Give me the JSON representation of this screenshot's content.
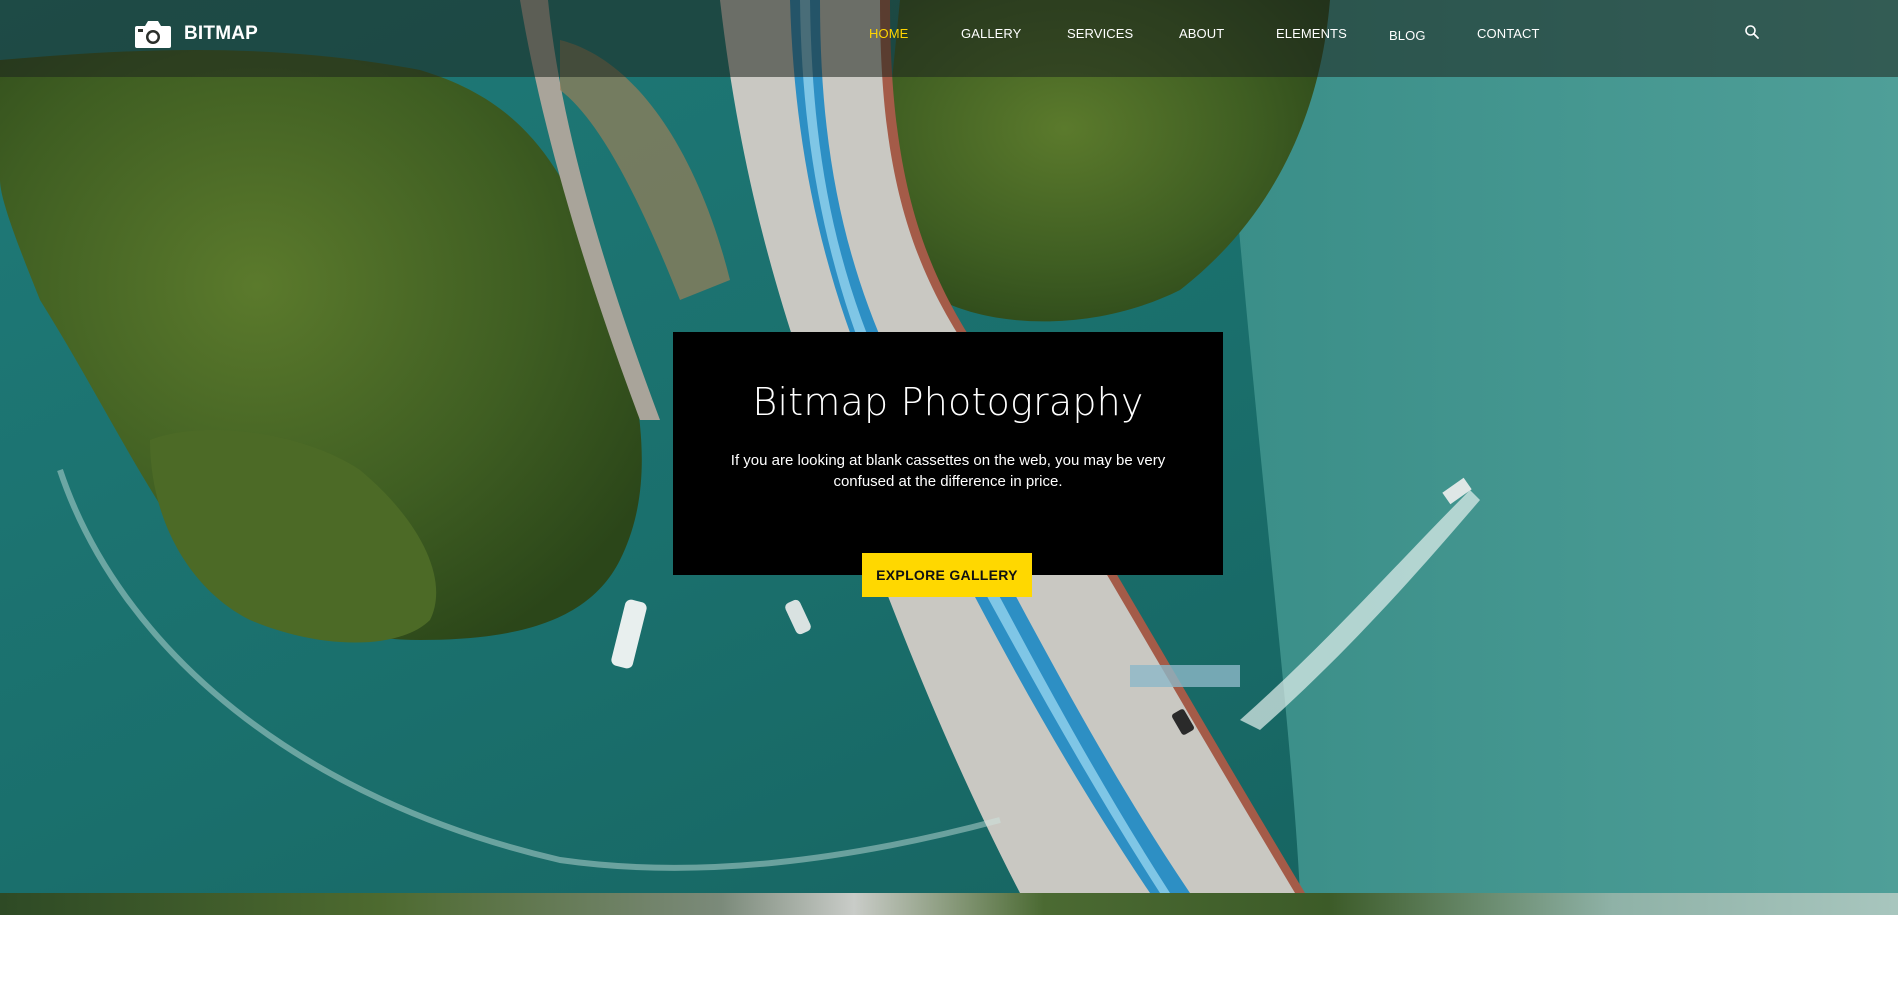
{
  "brand": {
    "name": "BITMAP",
    "logo_icon": "camera-icon"
  },
  "nav": {
    "items": [
      {
        "label": "HOME",
        "active": true
      },
      {
        "label": "GALLERY",
        "active": false
      },
      {
        "label": "SERVICES",
        "active": false
      },
      {
        "label": "ABOUT",
        "active": false
      },
      {
        "label": "ELEMENTS",
        "active": false
      },
      {
        "label": "BLOG",
        "active": false
      },
      {
        "label": "CONTACT",
        "active": false
      }
    ],
    "search_icon": "search-icon"
  },
  "hero": {
    "title": "Bitmap Photography",
    "text": "If you are looking at blank cassettes on the web, you may be very confused at the difference in price.",
    "cta_label": "EXPLORE GALLERY"
  },
  "colors": {
    "accent": "#ffd800",
    "active_nav": "#ffd400",
    "box_bg": "#000000",
    "water": "#2a8a83",
    "forest": "#3d5e22"
  }
}
